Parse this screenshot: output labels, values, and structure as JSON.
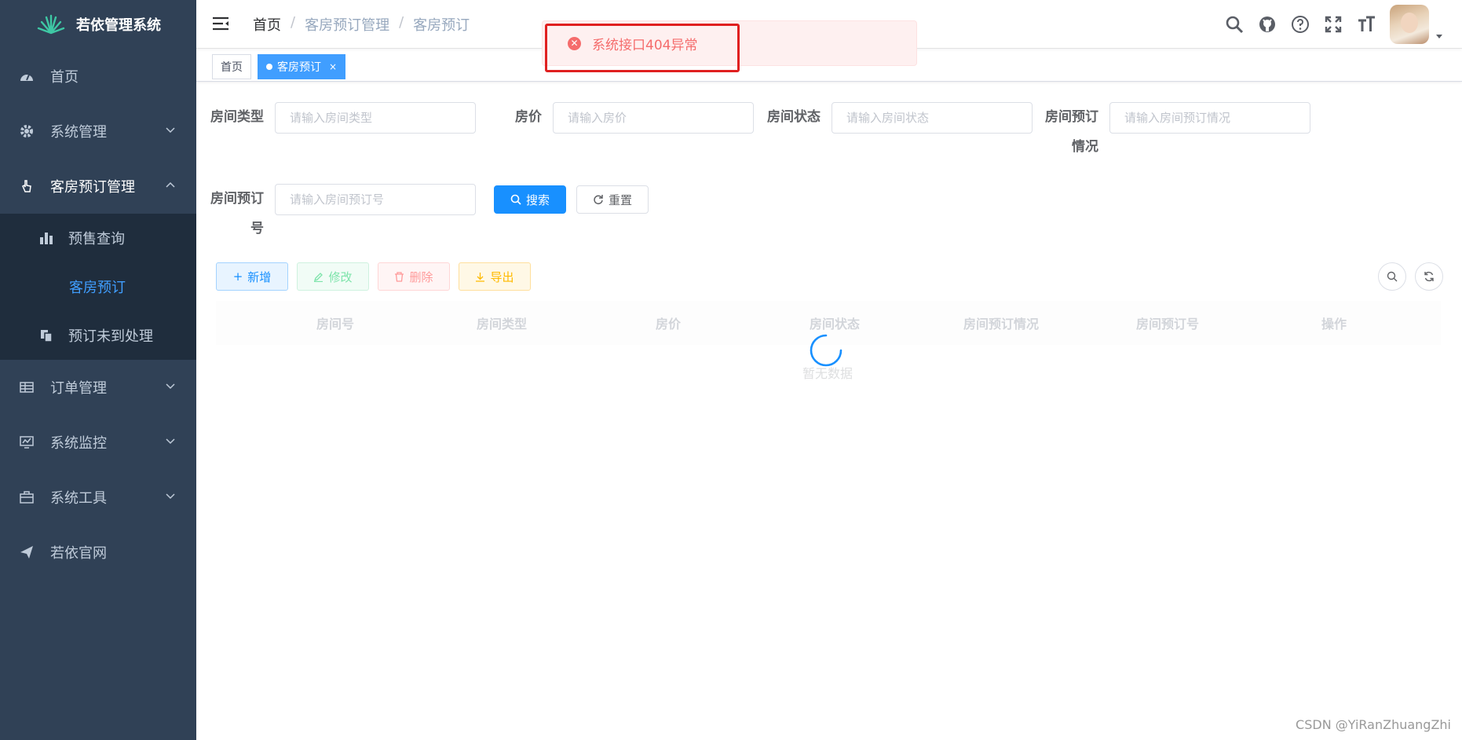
{
  "app": {
    "title": "若依管理系统"
  },
  "sidebar": {
    "items": [
      {
        "label": "首页",
        "icon": "dashboard-icon"
      },
      {
        "label": "系统管理",
        "icon": "gear-icon"
      },
      {
        "label": "客房预订管理",
        "icon": "hand-icon"
      },
      {
        "label": "订单管理",
        "icon": "table-icon"
      },
      {
        "label": "系统监控",
        "icon": "monitor-icon"
      },
      {
        "label": "系统工具",
        "icon": "toolbox-icon"
      },
      {
        "label": "若依官网",
        "icon": "send-icon"
      }
    ],
    "sub_items": [
      {
        "label": "预售查询",
        "icon": "bar-chart-icon"
      },
      {
        "label": "客房预订",
        "icon": ""
      },
      {
        "label": "预订未到处理",
        "icon": "copy-icon"
      }
    ]
  },
  "breadcrumb": [
    "首页",
    "客房预订管理",
    "客房预订"
  ],
  "toast": {
    "message": "系统接口404异常",
    "type": "error",
    "color": "#f56c6c"
  },
  "tags": [
    {
      "label": "首页"
    },
    {
      "label": "客房预订",
      "close": "×"
    }
  ],
  "form": {
    "fields": [
      {
        "label": "房间类型",
        "placeholder": "请输入房间类型"
      },
      {
        "label": "房价",
        "placeholder": "请输入房价"
      },
      {
        "label": "房间状态",
        "placeholder": "请输入房间状态"
      },
      {
        "label": "房间预订情况",
        "placeholder": "请输入房间预订情况"
      },
      {
        "label": "房间预订号",
        "placeholder": "请输入房间预订号"
      }
    ],
    "search_label": "搜索",
    "reset_label": "重置"
  },
  "toolbar": {
    "add_label": "新增",
    "edit_label": "修改",
    "delete_label": "删除",
    "export_label": "导出"
  },
  "table": {
    "columns": [
      "房间号",
      "房间类型",
      "房价",
      "房间状态",
      "房间预订情况",
      "房间预订号",
      "操作"
    ],
    "empty_text": "暂无数据",
    "loading": true
  },
  "watermark": "CSDN @YiRanZhuangZhi",
  "colors": {
    "sidebar_bg": "#304156",
    "primary": "#1890ff",
    "active_menu": "#409eff"
  }
}
